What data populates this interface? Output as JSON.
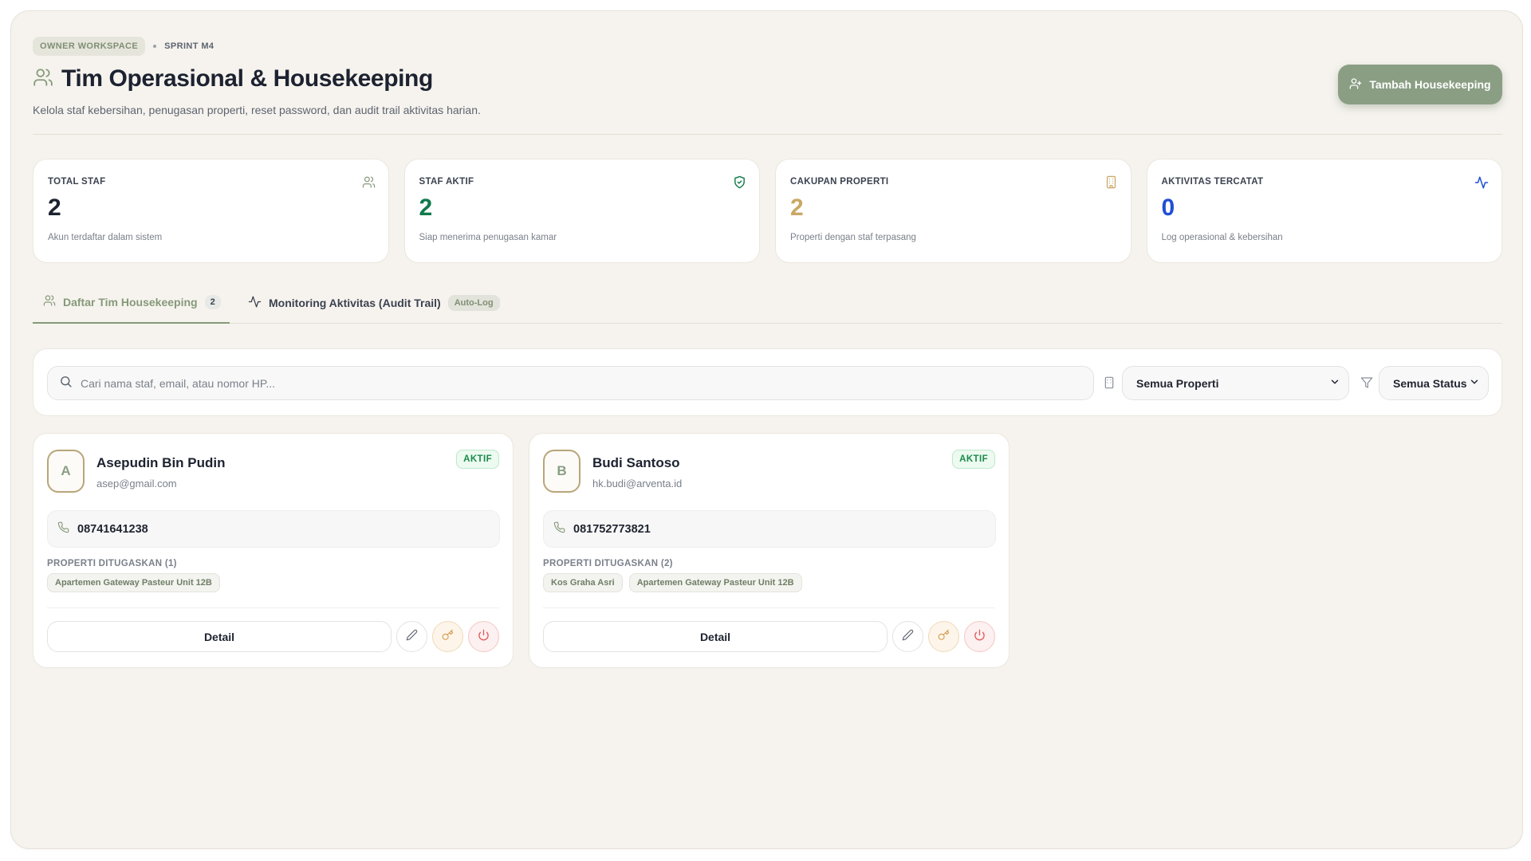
{
  "header": {
    "workspace": "OWNER WORKSPACE",
    "sprint": "SPRINT M4",
    "title": "Tim Operasional & Housekeeping",
    "subtitle": "Kelola staf kebersihan, penugasan properti, reset password, dan audit trail aktivitas harian.",
    "add_button": "Tambah Housekeeping"
  },
  "stats": [
    {
      "label": "TOTAL STAF",
      "value": "2",
      "desc": "Akun terdaftar dalam sistem",
      "icon": "users-icon",
      "color": "#1c2230"
    },
    {
      "label": "STAF AKTIF",
      "value": "2",
      "desc": "Siap menerima penugasan kamar",
      "icon": "shield-check-icon",
      "color": "#0f7a4a"
    },
    {
      "label": "CAKUPAN PROPERTI",
      "value": "2",
      "desc": "Properti dengan staf terpasang",
      "icon": "building-icon",
      "color": "#c9a866"
    },
    {
      "label": "AKTIVITAS TERCATAT",
      "value": "0",
      "desc": "Log operasional & kebersihan",
      "icon": "activity-icon",
      "color": "#1f4fd6"
    }
  ],
  "tabs": {
    "team": {
      "label": "Daftar Tim Housekeeping",
      "count": "2"
    },
    "monitoring": {
      "label": "Monitoring Aktivitas (Audit Trail)",
      "badge": "Auto-Log"
    }
  },
  "filter": {
    "search_placeholder": "Cari nama staf, email, atau nomor HP...",
    "property": "Semua Properti",
    "status": "Semua Status"
  },
  "staff": [
    {
      "initial": "A",
      "name": "Asepudin Bin Pudin",
      "email": "asep@gmail.com",
      "status": "AKTIF",
      "phone": "08741641238",
      "assigned_label": "PROPERTI DITUGASKAN (1)",
      "properties": [
        "Apartemen Gateway Pasteur Unit 12B"
      ],
      "detail_label": "Detail"
    },
    {
      "initial": "B",
      "name": "Budi Santoso",
      "email": "hk.budi@arventa.id",
      "status": "AKTIF",
      "phone": "081752773821",
      "assigned_label": "PROPERTI DITUGASKAN (2)",
      "properties": [
        "Kos Graha Asri",
        "Apartemen Gateway Pasteur Unit 12B"
      ],
      "detail_label": "Detail"
    }
  ],
  "colors": {
    "accent": "#8a9e84",
    "active": "#1b8a4b",
    "danger": "#e05656",
    "warning": "#d49b4c"
  }
}
